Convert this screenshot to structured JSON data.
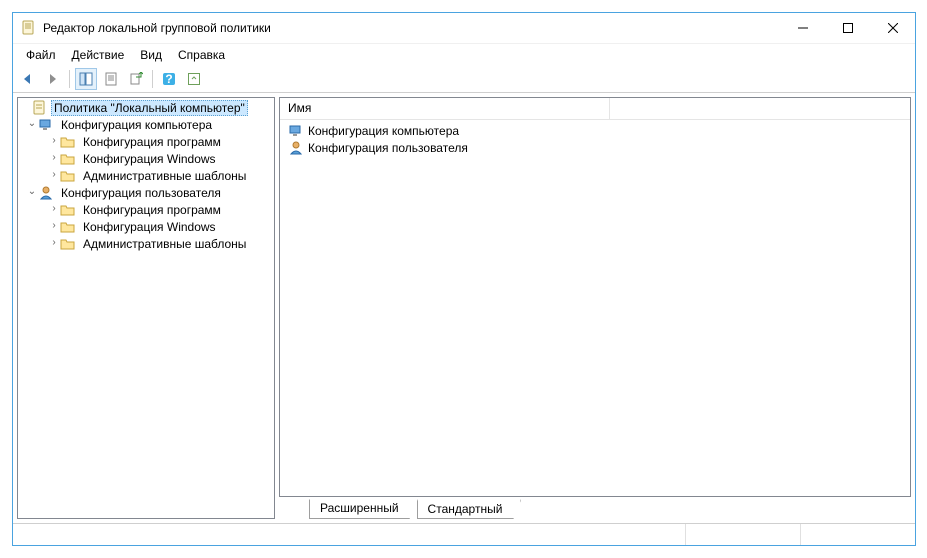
{
  "window": {
    "title": "Редактор локальной групповой политики"
  },
  "menu": {
    "file": "Файл",
    "action": "Действие",
    "view": "Вид",
    "help": "Справка"
  },
  "tree": {
    "root": "Политика \"Локальный компьютер\"",
    "comp": "Конфигурация компьютера",
    "comp_soft": "Конфигурация программ",
    "comp_win": "Конфигурация Windows",
    "comp_adm": "Административные шаблоны",
    "user": "Конфигурация пользователя",
    "user_soft": "Конфигурация программ",
    "user_win": "Конфигурация Windows",
    "user_adm": "Административные шаблоны"
  },
  "list": {
    "header": "Имя",
    "item1": "Конфигурация компьютера",
    "item2": "Конфигурация пользователя"
  },
  "tabs": {
    "extended": "Расширенный",
    "standard": "Стандартный"
  }
}
